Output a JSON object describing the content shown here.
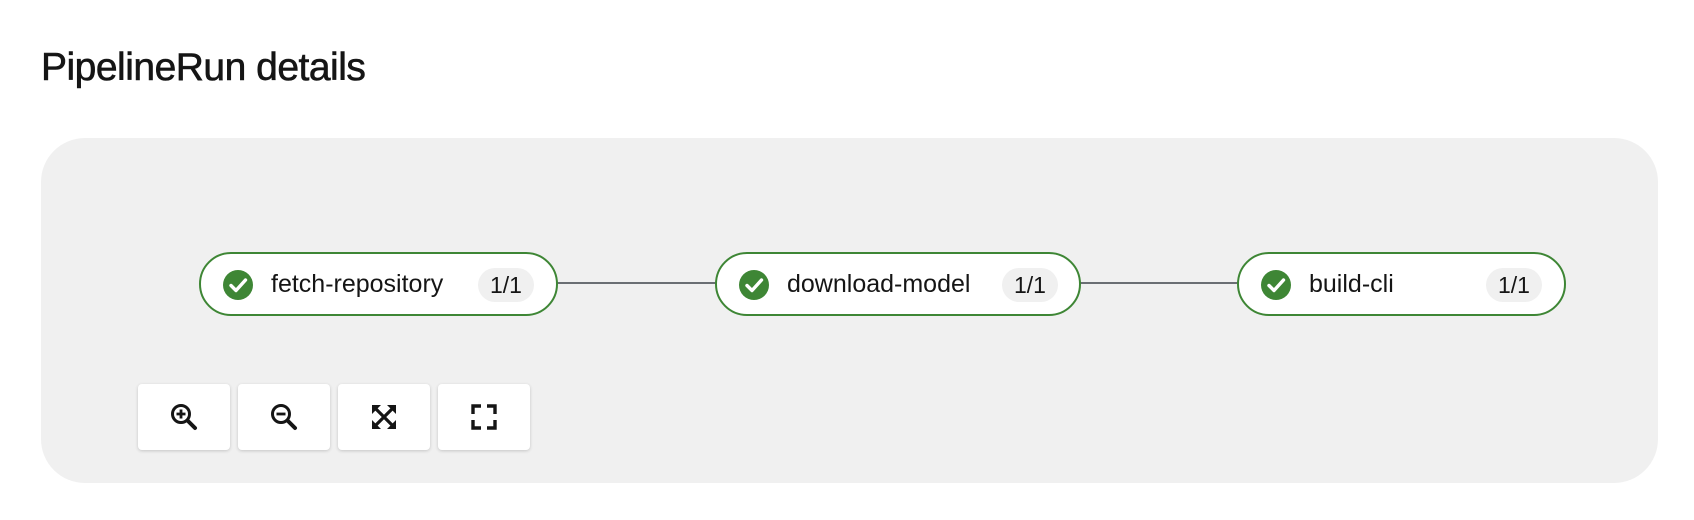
{
  "page": {
    "title": "PipelineRun details"
  },
  "pipeline": {
    "tasks": [
      {
        "name": "fetch-repository",
        "badge": "1/1",
        "status": "succeeded"
      },
      {
        "name": "download-model",
        "badge": "1/1",
        "status": "succeeded"
      },
      {
        "name": "build-cli",
        "badge": "1/1",
        "status": "succeeded"
      }
    ]
  },
  "controls": [
    {
      "icon": "zoom-in-icon"
    },
    {
      "icon": "zoom-out-icon"
    },
    {
      "icon": "fit-to-screen-icon"
    },
    {
      "icon": "reset-view-icon"
    }
  ],
  "colors": {
    "success": "#3e8635",
    "edge": "#6a6e73",
    "canvas": "#f0f0f0"
  }
}
